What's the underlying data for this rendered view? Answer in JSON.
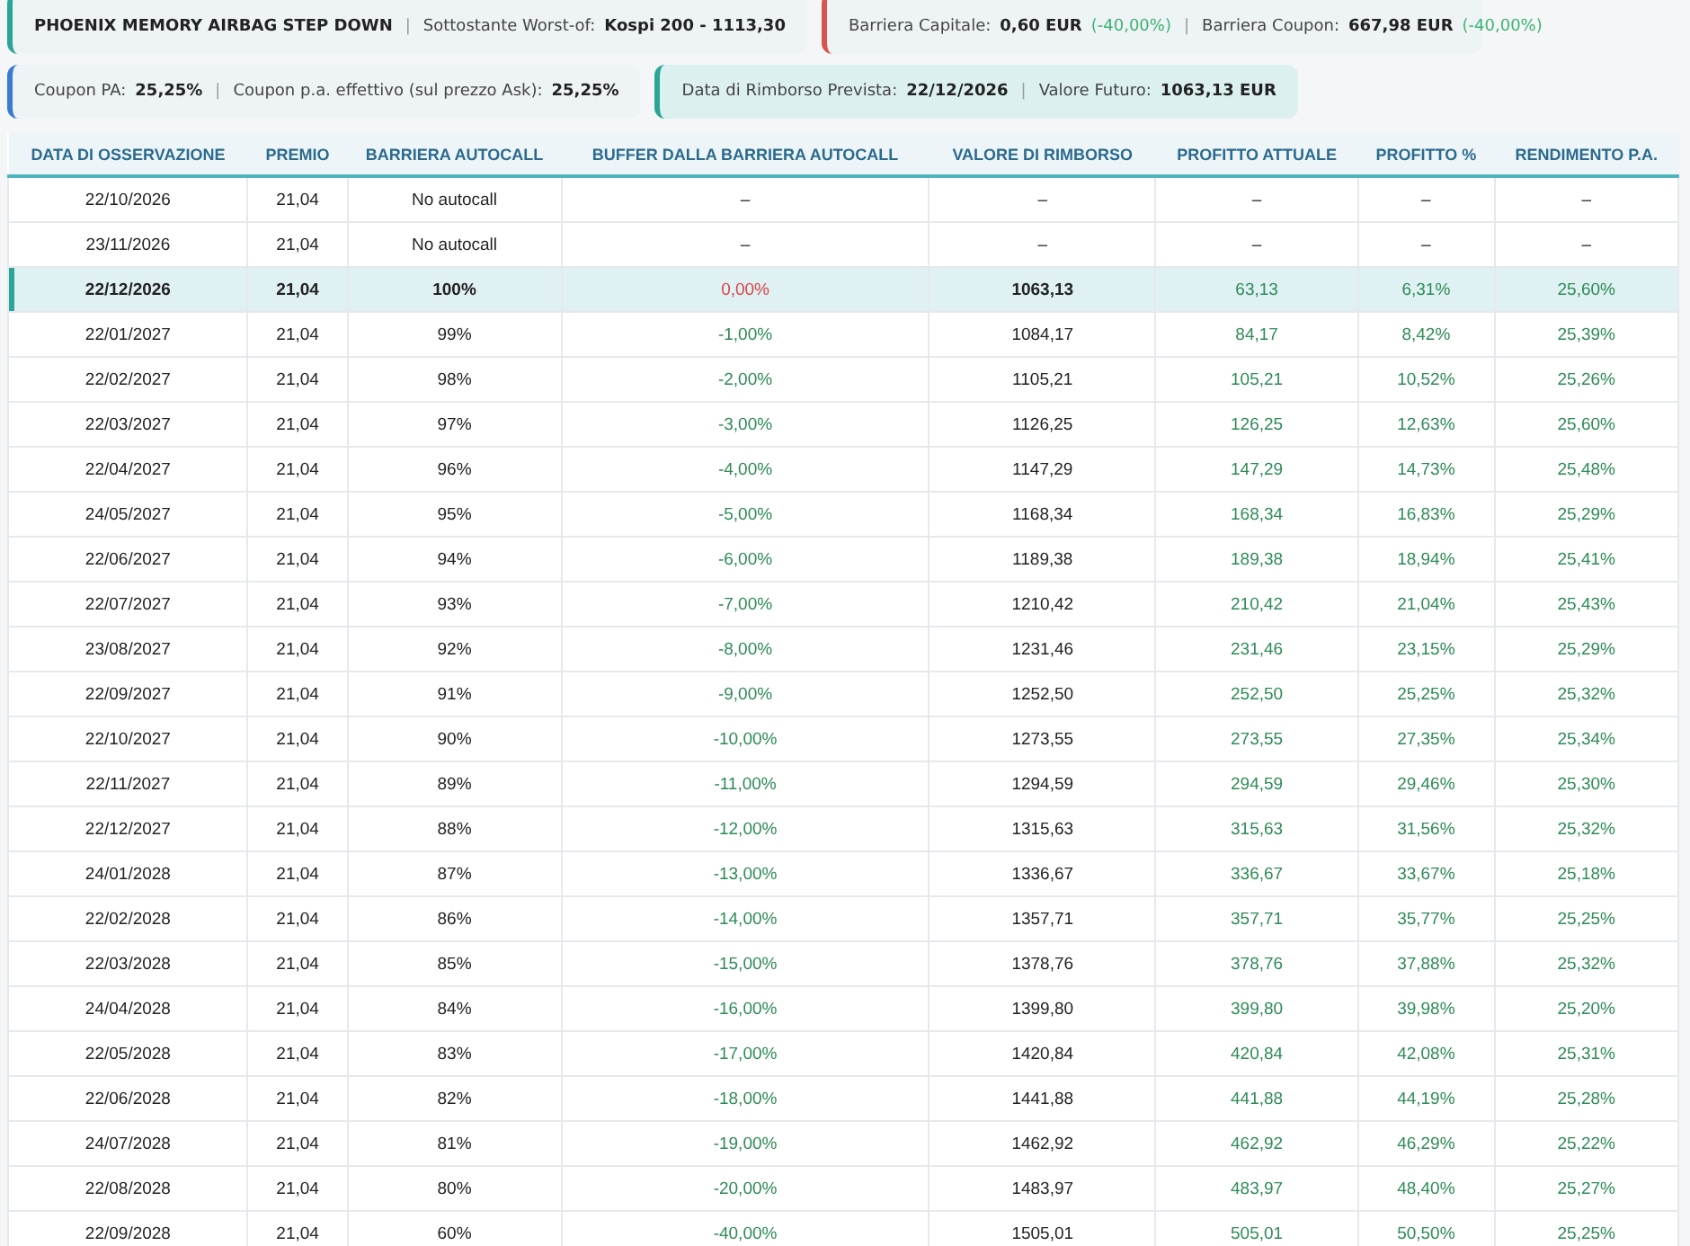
{
  "summary_cards": [
    {
      "color": "#2aa598",
      "highlighted": false,
      "items": [
        {
          "value": "PHOENIX MEMORY AIRBAG STEP DOWN"
        },
        {
          "label": "Sottostante Worst-of:",
          "value": "Kospi 200 - 1113,30"
        }
      ]
    },
    {
      "color": "#d9534f",
      "highlighted": false,
      "items": [
        {
          "label": "Barriera Capitale:",
          "value": "0,60 EUR",
          "change": "(-40,00%)"
        },
        {
          "label": "Barriera Coupon:",
          "value": "667,98 EUR",
          "change": "(-40,00%)"
        }
      ]
    },
    {
      "color": "#3b7bd4",
      "highlighted": false,
      "items": [
        {
          "label": "Coupon PA:",
          "value": "25,25%"
        },
        {
          "label": "Coupon p.a. effettivo (sul prezzo Ask):",
          "value": "25,25%"
        }
      ]
    },
    {
      "color": "#2aa598",
      "highlighted": true,
      "items": [
        {
          "label": "Data di Rimborso Prevista:",
          "value": "22/12/2026"
        },
        {
          "label": "Valore Futuro:",
          "value": "1063,13 EUR"
        }
      ]
    }
  ],
  "separator": "|",
  "table": {
    "columns": [
      "DATA DI OSSERVAZIONE",
      "PREMIO",
      "BARRIERA AUTOCALL",
      "BUFFER DALLA BARRIERA AUTOCALL",
      "VALORE DI RIMBORSO",
      "PROFITTO ATTUALE",
      "PROFITTO %",
      "RENDIMENTO P.A."
    ],
    "rows": [
      {
        "selected": false,
        "kind": "no_autocall",
        "buffer_alert": false,
        "cells": [
          "22/10/2026",
          "21,04",
          "No autocall",
          "–",
          "–",
          "–",
          "–",
          "–"
        ]
      },
      {
        "selected": false,
        "kind": "no_autocall",
        "buffer_alert": false,
        "cells": [
          "23/11/2026",
          "21,04",
          "No autocall",
          "–",
          "–",
          "–",
          "–",
          "–"
        ]
      },
      {
        "selected": true,
        "kind": "autocall",
        "buffer_alert": true,
        "cells": [
          "22/12/2026",
          "21,04",
          "100%",
          "0,00%",
          "1063,13",
          "63,13",
          "6,31%",
          "25,60%"
        ]
      },
      {
        "selected": false,
        "kind": "autocall",
        "buffer_alert": false,
        "cells": [
          "22/01/2027",
          "21,04",
          "99%",
          "-1,00%",
          "1084,17",
          "84,17",
          "8,42%",
          "25,39%"
        ]
      },
      {
        "selected": false,
        "kind": "autocall",
        "buffer_alert": false,
        "cells": [
          "22/02/2027",
          "21,04",
          "98%",
          "-2,00%",
          "1105,21",
          "105,21",
          "10,52%",
          "25,26%"
        ]
      },
      {
        "selected": false,
        "kind": "autocall",
        "buffer_alert": false,
        "cells": [
          "22/03/2027",
          "21,04",
          "97%",
          "-3,00%",
          "1126,25",
          "126,25",
          "12,63%",
          "25,60%"
        ]
      },
      {
        "selected": false,
        "kind": "autocall",
        "buffer_alert": false,
        "cells": [
          "22/04/2027",
          "21,04",
          "96%",
          "-4,00%",
          "1147,29",
          "147,29",
          "14,73%",
          "25,48%"
        ]
      },
      {
        "selected": false,
        "kind": "autocall",
        "buffer_alert": false,
        "cells": [
          "24/05/2027",
          "21,04",
          "95%",
          "-5,00%",
          "1168,34",
          "168,34",
          "16,83%",
          "25,29%"
        ]
      },
      {
        "selected": false,
        "kind": "autocall",
        "buffer_alert": false,
        "cells": [
          "22/06/2027",
          "21,04",
          "94%",
          "-6,00%",
          "1189,38",
          "189,38",
          "18,94%",
          "25,41%"
        ]
      },
      {
        "selected": false,
        "kind": "autocall",
        "buffer_alert": false,
        "cells": [
          "22/07/2027",
          "21,04",
          "93%",
          "-7,00%",
          "1210,42",
          "210,42",
          "21,04%",
          "25,43%"
        ]
      },
      {
        "selected": false,
        "kind": "autocall",
        "buffer_alert": false,
        "cells": [
          "23/08/2027",
          "21,04",
          "92%",
          "-8,00%",
          "1231,46",
          "231,46",
          "23,15%",
          "25,29%"
        ]
      },
      {
        "selected": false,
        "kind": "autocall",
        "buffer_alert": false,
        "cells": [
          "22/09/2027",
          "21,04",
          "91%",
          "-9,00%",
          "1252,50",
          "252,50",
          "25,25%",
          "25,32%"
        ]
      },
      {
        "selected": false,
        "kind": "autocall",
        "buffer_alert": false,
        "cells": [
          "22/10/2027",
          "21,04",
          "90%",
          "-10,00%",
          "1273,55",
          "273,55",
          "27,35%",
          "25,34%"
        ]
      },
      {
        "selected": false,
        "kind": "autocall",
        "buffer_alert": false,
        "cells": [
          "22/11/2027",
          "21,04",
          "89%",
          "-11,00%",
          "1294,59",
          "294,59",
          "29,46%",
          "25,30%"
        ]
      },
      {
        "selected": false,
        "kind": "autocall",
        "buffer_alert": false,
        "cells": [
          "22/12/2027",
          "21,04",
          "88%",
          "-12,00%",
          "1315,63",
          "315,63",
          "31,56%",
          "25,32%"
        ]
      },
      {
        "selected": false,
        "kind": "autocall",
        "buffer_alert": false,
        "cells": [
          "24/01/2028",
          "21,04",
          "87%",
          "-13,00%",
          "1336,67",
          "336,67",
          "33,67%",
          "25,18%"
        ]
      },
      {
        "selected": false,
        "kind": "autocall",
        "buffer_alert": false,
        "cells": [
          "22/02/2028",
          "21,04",
          "86%",
          "-14,00%",
          "1357,71",
          "357,71",
          "35,77%",
          "25,25%"
        ]
      },
      {
        "selected": false,
        "kind": "autocall",
        "buffer_alert": false,
        "cells": [
          "22/03/2028",
          "21,04",
          "85%",
          "-15,00%",
          "1378,76",
          "378,76",
          "37,88%",
          "25,32%"
        ]
      },
      {
        "selected": false,
        "kind": "autocall",
        "buffer_alert": false,
        "cells": [
          "24/04/2028",
          "21,04",
          "84%",
          "-16,00%",
          "1399,80",
          "399,80",
          "39,98%",
          "25,20%"
        ]
      },
      {
        "selected": false,
        "kind": "autocall",
        "buffer_alert": false,
        "cells": [
          "22/05/2028",
          "21,04",
          "83%",
          "-17,00%",
          "1420,84",
          "420,84",
          "42,08%",
          "25,31%"
        ]
      },
      {
        "selected": false,
        "kind": "autocall",
        "buffer_alert": false,
        "cells": [
          "22/06/2028",
          "21,04",
          "82%",
          "-18,00%",
          "1441,88",
          "441,88",
          "44,19%",
          "25,28%"
        ]
      },
      {
        "selected": false,
        "kind": "autocall",
        "buffer_alert": false,
        "cells": [
          "24/07/2028",
          "21,04",
          "81%",
          "-19,00%",
          "1462,92",
          "462,92",
          "46,29%",
          "25,22%"
        ]
      },
      {
        "selected": false,
        "kind": "autocall",
        "buffer_alert": false,
        "cells": [
          "22/08/2028",
          "21,04",
          "80%",
          "-20,00%",
          "1483,97",
          "483,97",
          "48,40%",
          "25,27%"
        ]
      },
      {
        "selected": false,
        "kind": "autocall",
        "buffer_alert": false,
        "cells": [
          "22/09/2028",
          "21,04",
          "60%",
          "-40,00%",
          "1505,01",
          "505,01",
          "50,50%",
          "25,25%"
        ]
      }
    ]
  }
}
